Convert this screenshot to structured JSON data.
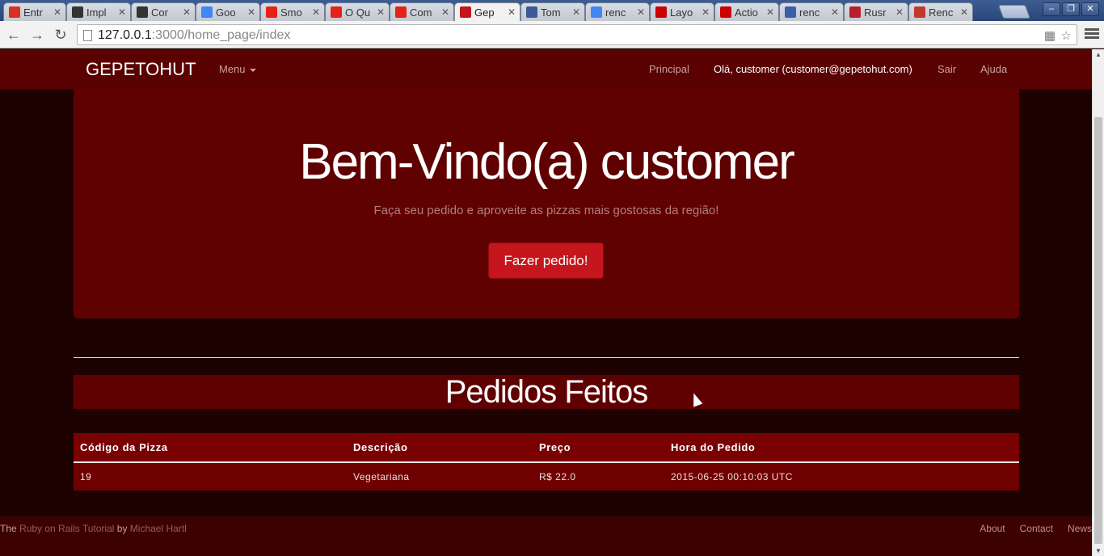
{
  "browser": {
    "tabs": [
      {
        "title": "Entr",
        "icon": "gmail-icon",
        "color": "#d93025"
      },
      {
        "title": "Impl",
        "icon": "github-icon",
        "color": "#333333"
      },
      {
        "title": "Cor",
        "icon": "github-icon",
        "color": "#333333"
      },
      {
        "title": "Goo",
        "icon": "translate-icon",
        "color": "#4285f4"
      },
      {
        "title": "Smo",
        "icon": "youtube-icon",
        "color": "#e62117"
      },
      {
        "title": "O Qu",
        "icon": "youtube-icon",
        "color": "#e62117"
      },
      {
        "title": "Com",
        "icon": "youtube-icon",
        "color": "#e62117"
      },
      {
        "title": "Gep",
        "icon": "pizza-icon",
        "color": "#c4161c",
        "active": true
      },
      {
        "title": "Tom",
        "icon": "facebook-icon",
        "color": "#3b5998"
      },
      {
        "title": "renc",
        "icon": "google-icon",
        "color": "#4285f4"
      },
      {
        "title": "Layo",
        "icon": "rails-icon",
        "color": "#cc0000"
      },
      {
        "title": "Actio",
        "icon": "rails-icon",
        "color": "#cc0000"
      },
      {
        "title": "renc",
        "icon": "a-icon",
        "color": "#3b5ea8"
      },
      {
        "title": "Rusr",
        "icon": "rss-icon",
        "color": "#b81e2d"
      },
      {
        "title": "Renc",
        "icon": "trash-icon",
        "color": "#c0392b"
      }
    ],
    "url_host": "127.0.0.1",
    "url_path": ":3000/home_page/index"
  },
  "navbar": {
    "brand": "GEPETOHUT",
    "menu_label": "Menu",
    "principal": "Principal",
    "user_greeting": "Olá, customer (customer@gepetohut.com)",
    "logout": "Sair",
    "help": "Ajuda"
  },
  "hero": {
    "title": "Bem-Vindo(a) customer",
    "subtitle": "Faça seu pedido e aproveite as pizzas mais gostosas da região!",
    "cta": "Fazer pedido!"
  },
  "orders": {
    "title": "Pedidos Feitos",
    "headers": [
      "Código da Pizza",
      "Descrição",
      "Preço",
      "Hora do Pedido"
    ],
    "rows": [
      [
        "19",
        "Vegetariana",
        "R$ 22.0",
        "2015-06-25 00:10:03 UTC"
      ]
    ]
  },
  "footer": {
    "prefix": "The",
    "link1": "Ruby on Rails Tutorial",
    "by": "by",
    "link2": "Michael Hartl",
    "links": [
      "About",
      "Contact",
      "News"
    ]
  }
}
